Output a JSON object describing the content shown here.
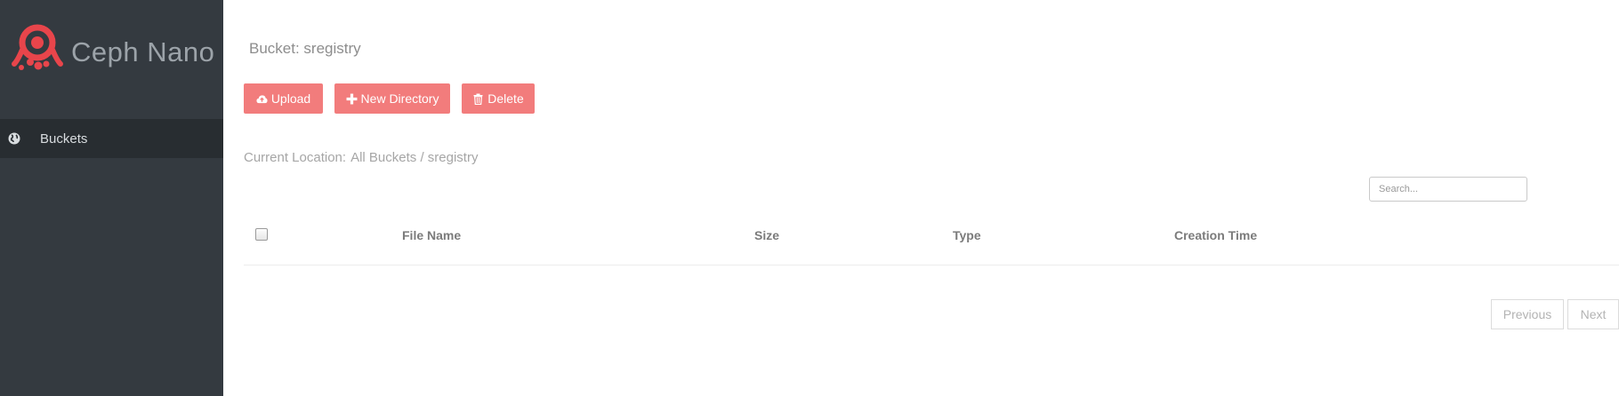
{
  "sidebar": {
    "brand": {
      "name": "Ceph Nano",
      "logo_icon": "ceph-octopus-logo"
    },
    "items": [
      {
        "label": "Buckets",
        "icon": "globe-icon"
      }
    ]
  },
  "main": {
    "title": "Bucket: sregistry",
    "toolbar": {
      "upload_label": "Upload",
      "upload_icon": "cloud-upload-icon",
      "new_directory_label": "New Directory",
      "new_directory_icon": "plus-icon",
      "delete_label": "Delete",
      "delete_icon": "trash-icon"
    },
    "location": {
      "label": "Current Location:",
      "path": "All Buckets / sregistry"
    },
    "search": {
      "placeholder": "Search...",
      "value": ""
    },
    "table": {
      "columns": [
        "File Name",
        "Size",
        "Type",
        "Creation Time"
      ],
      "rows": []
    },
    "pagination": {
      "previous_label": "Previous",
      "next_label": "Next"
    }
  },
  "colors": {
    "sidebar_bg": "#343a40",
    "sidebar_active": "#282d31",
    "accent": "#f27c7c",
    "logo": "#e8454b"
  }
}
